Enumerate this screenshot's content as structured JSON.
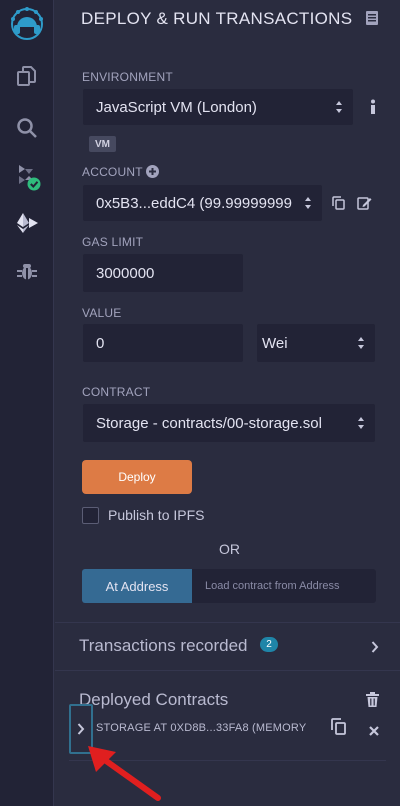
{
  "panel": {
    "title": "DEPLOY & RUN TRANSACTIONS"
  },
  "environment": {
    "label": "ENVIRONMENT",
    "value": "JavaScript VM (London)",
    "badge": "VM"
  },
  "account": {
    "label": "ACCOUNT",
    "value": "0x5B3...eddC4 (99.99999999"
  },
  "gas_limit": {
    "label": "GAS LIMIT",
    "value": "3000000"
  },
  "value_field": {
    "label": "VALUE",
    "amount": "0",
    "unit": "Wei"
  },
  "contract": {
    "label": "CONTRACT",
    "value": "Storage - contracts/00-storage.sol"
  },
  "deploy": {
    "label": "Deploy"
  },
  "publish": {
    "label": "Publish to IPFS",
    "checked": false
  },
  "or_label": "OR",
  "at_address": {
    "button_label": "At Address",
    "placeholder": "Load contract from Address"
  },
  "transactions": {
    "title": "Transactions recorded",
    "count": "2"
  },
  "deployed": {
    "title": "Deployed Contracts",
    "instances": [
      {
        "label": "STORAGE AT 0XD8B...33FA8 (MEMORY"
      }
    ]
  },
  "colors": {
    "background": "#2a2c3f",
    "sidebar": "#222336",
    "deploy_button": "#dd7b45",
    "at_address_button": "#356a93",
    "badge": "#1f85a8",
    "annotation_arrow": "#e01f1f",
    "success_check": "#2fbc7d"
  },
  "icons": [
    "remix-logo-icon",
    "file-explorer-icon",
    "search-icon",
    "solidity-compiler-icon",
    "deploy-run-icon",
    "debugger-icon",
    "docs-icon",
    "info-icon",
    "add-account-icon",
    "copy-icon",
    "edit-icon",
    "chevron-right-icon",
    "trash-icon",
    "close-icon"
  ]
}
